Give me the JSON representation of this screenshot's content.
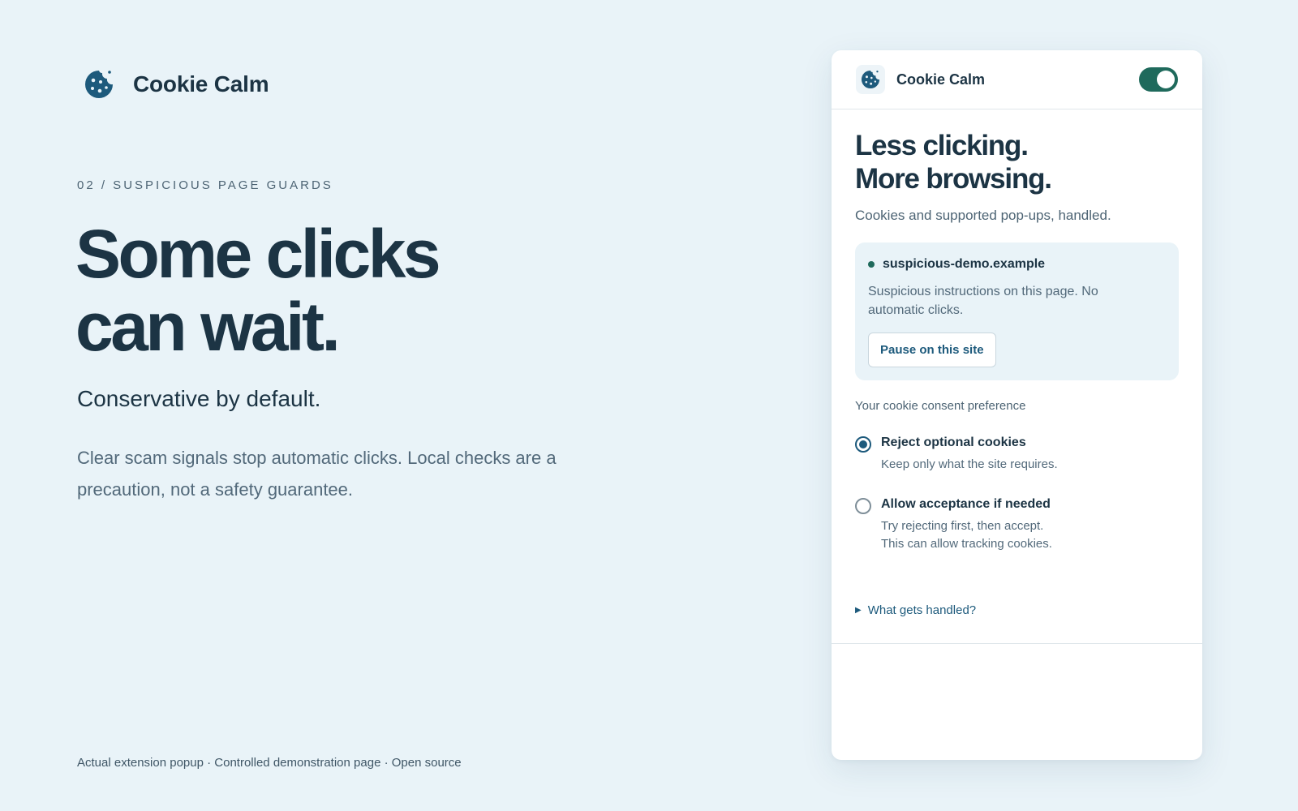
{
  "brand": {
    "name": "Cookie Calm",
    "logo_icon": "cookie-icon"
  },
  "hero": {
    "eyebrow": "02 / SUSPICIOUS PAGE GUARDS",
    "title_line1": "Some clicks",
    "title_line2": "can wait.",
    "subtitle": "Conservative by default.",
    "body": "Clear scam signals stop automatic clicks. Local checks are a precaution, not a safety guarantee."
  },
  "footer": {
    "text": "Actual extension popup · Controlled demonstration page · Open source"
  },
  "popup": {
    "header": {
      "name": "Cookie Calm",
      "logo_icon": "cookie-icon",
      "enabled": true
    },
    "title_line1": "Less clicking.",
    "title_line2": "More browsing.",
    "tagline": "Cookies and supported pop-ups, handled.",
    "site": {
      "domain": "suspicious-demo.example",
      "note": "Suspicious instructions on this page. No automatic clicks.",
      "pause_label": "Pause on this site"
    },
    "preference_label": "Your cookie consent preference",
    "options": [
      {
        "title": "Reject optional cookies",
        "desc_line1": "Keep only what the site requires.",
        "desc_line2": "",
        "selected": true
      },
      {
        "title": "Allow acceptance if needed",
        "desc_line1": "Try rejecting first, then accept.",
        "desc_line2": "This can allow tracking cookies.",
        "selected": false
      }
    ],
    "details_label": "What gets handled?"
  },
  "colors": {
    "background": "#e9f3f8",
    "text_primary": "#1c3444",
    "accent_blue": "#1d5a7c",
    "accent_green": "#1f6a5c"
  }
}
